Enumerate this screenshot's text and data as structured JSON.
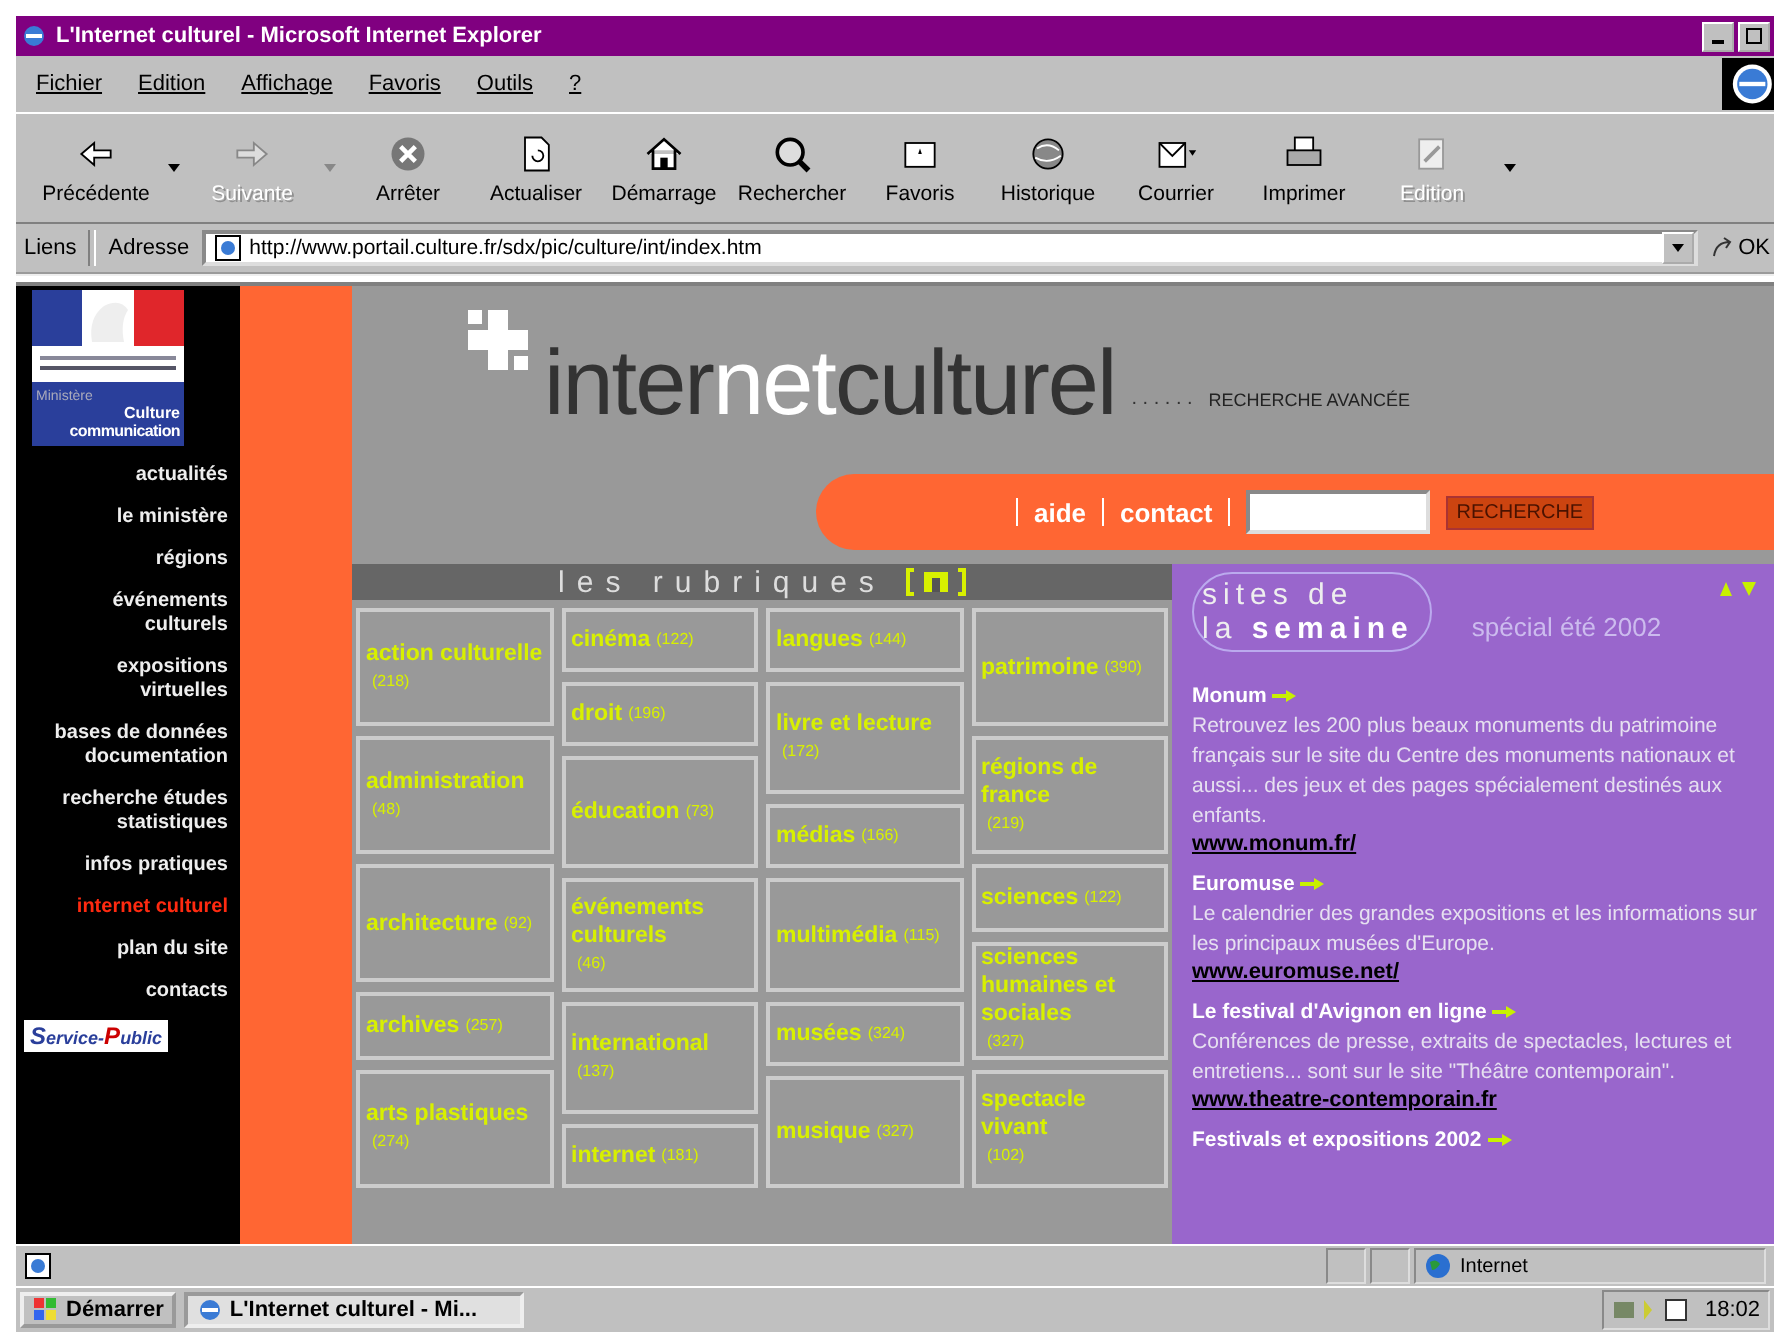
{
  "window": {
    "title": "L'Internet culturel - Microsoft Internet Explorer"
  },
  "menu": [
    "Fichier",
    "Edition",
    "Affichage",
    "Favoris",
    "Outils",
    "?"
  ],
  "toolbar": [
    {
      "kind": "back",
      "label": "Précédente",
      "disabled": false,
      "dropdown": true
    },
    {
      "kind": "forward",
      "label": "Suivante",
      "disabled": true,
      "dropdown": true
    },
    {
      "kind": "stop",
      "label": "Arrêter",
      "disabled": false,
      "dropdown": false
    },
    {
      "kind": "refresh",
      "label": "Actualiser",
      "disabled": false,
      "dropdown": false
    },
    {
      "kind": "home",
      "label": "Démarrage",
      "disabled": false,
      "dropdown": false
    },
    {
      "kind": "search",
      "label": "Rechercher",
      "disabled": false,
      "dropdown": false
    },
    {
      "kind": "favorites",
      "label": "Favoris",
      "disabled": false,
      "dropdown": false
    },
    {
      "kind": "history",
      "label": "Historique",
      "disabled": false,
      "dropdown": false
    },
    {
      "kind": "mail",
      "label": "Courrier",
      "disabled": false,
      "dropdown": false
    },
    {
      "kind": "print",
      "label": "Imprimer",
      "disabled": false,
      "dropdown": false
    },
    {
      "kind": "edit",
      "label": "Edition",
      "disabled": true,
      "dropdown": false
    }
  ],
  "address": {
    "links_label": "Liens",
    "label": "Adresse",
    "url": "http://www.portail.culture.fr/sdx/pic/culture/int/index.htm",
    "go": "OK"
  },
  "sidebar": {
    "logo": {
      "line_1": "Ministère",
      "line_2": "Culture",
      "line_3": "communication"
    },
    "items": [
      {
        "label": "actualités",
        "selected": false
      },
      {
        "label": "le ministère",
        "selected": false
      },
      {
        "label": "régions",
        "selected": false
      },
      {
        "label": "événements culturels",
        "selected": false
      },
      {
        "label": "expositions virtuelles",
        "selected": false
      },
      {
        "label": "bases de données documentation",
        "selected": false
      },
      {
        "label": "recherche études statistiques",
        "selected": false
      },
      {
        "label": "infos pratiques",
        "selected": false
      },
      {
        "label": "internet culturel",
        "selected": true
      },
      {
        "label": "plan du site",
        "selected": false
      },
      {
        "label": "contacts",
        "selected": false
      }
    ],
    "badge": {
      "first": "S",
      "rest_1": "ervice-",
      "second": "P",
      "rest_2": "ublic"
    }
  },
  "header": {
    "logo_1": "inter",
    "logo_2": "net",
    "logo_3": "culturel",
    "dots": ". . . . . .",
    "advanced_search": "RECHERCHE AVANCÉE",
    "nav": [
      {
        "label": "aide"
      },
      {
        "label": "contact"
      }
    ],
    "search_button": "RECHERCHE"
  },
  "rubriques": {
    "title": "les rubriques",
    "columns": [
      [
        {
          "name": "action culturelle",
          "count": "(218)",
          "kind": "tall"
        },
        {
          "name": "administration",
          "count": "(48)",
          "kind": "tall"
        },
        {
          "name": "architecture",
          "count": "(92)",
          "kind": "tall"
        },
        {
          "name": "archives",
          "count": "(257)",
          "kind": "short"
        },
        {
          "name": "arts plastiques",
          "count": "(274)",
          "kind": "tall"
        }
      ],
      [
        {
          "name": "cinéma",
          "count": "(122)",
          "kind": "short"
        },
        {
          "name": "droit",
          "count": "(196)",
          "kind": "short"
        },
        {
          "name": "éducation",
          "count": "(73)",
          "kind": "tall"
        },
        {
          "name": "événements culturels",
          "count": "(46)",
          "kind": "tall"
        },
        {
          "name": "international",
          "count": "(137)",
          "kind": "tall"
        },
        {
          "name": "internet",
          "count": "(181)",
          "kind": "short"
        }
      ],
      [
        {
          "name": "langues",
          "count": "(144)",
          "kind": "short"
        },
        {
          "name": "livre et lecture",
          "count": "(172)",
          "kind": "tall"
        },
        {
          "name": "médias",
          "count": "(166)",
          "kind": "short"
        },
        {
          "name": "multimédia",
          "count": "(115)",
          "kind": "tall"
        },
        {
          "name": "musées",
          "count": "(324)",
          "kind": "short"
        },
        {
          "name": "musique",
          "count": "(327)",
          "kind": "tall"
        }
      ],
      [
        {
          "name": "patrimoine",
          "count": "(390)",
          "kind": "tall"
        },
        {
          "name": "régions de france",
          "count": "(219)",
          "kind": "tall"
        },
        {
          "name": "sciences",
          "count": "(122)",
          "kind": "short"
        },
        {
          "name": "sciences humaines et sociales",
          "count": "(327)",
          "kind": "tall"
        },
        {
          "name": "spectacle vivant",
          "count": "(102)",
          "kind": "tall"
        }
      ]
    ]
  },
  "sites": {
    "title_1": "sites de",
    "title_2a": "la",
    "title_2b": "semaine",
    "special": "spécial été 2002",
    "entries": [
      {
        "title": "Monum",
        "text": "Retrouvez les 200 plus beaux monuments du patrimoine français sur le site du Centre des monuments nationaux et aussi... des jeux et des pages spécialement destinés aux enfants.",
        "link": "www.monum.fr/"
      },
      {
        "title": "Euromuse",
        "text": "Le calendrier des grandes expositions et les informations sur les principaux musées d'Europe.",
        "link": "www.euromuse.net/"
      },
      {
        "title": "Le festival d'Avignon en ligne",
        "text": "Conférences de presse, extraits de spectacles, lectures et entretiens... sont sur le site \"Théâtre contemporain\".",
        "link": "www.theatre-contemporain.fr"
      },
      {
        "title": "Festivals et expositions 2002"
      }
    ]
  },
  "status_bar": {
    "zone": "Internet"
  },
  "taskbar": {
    "start": "Démarrer",
    "task": "L'Internet culturel - Mi...",
    "clock": "18:02"
  }
}
